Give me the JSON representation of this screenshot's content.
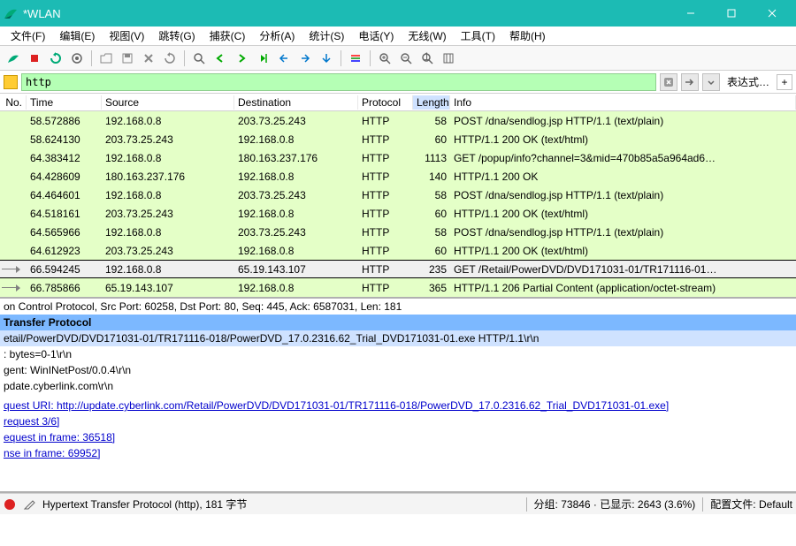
{
  "title": "*WLAN",
  "menu": [
    "文件(F)",
    "编辑(E)",
    "视图(V)",
    "跳转(G)",
    "捕获(C)",
    "分析(A)",
    "统计(S)",
    "电话(Y)",
    "无线(W)",
    "工具(T)",
    "帮助(H)"
  ],
  "filter": {
    "value": "http",
    "expr_label": "表达式…",
    "plus": "+"
  },
  "columns": {
    "no": "No.",
    "time": "Time",
    "src": "Source",
    "dst": "Destination",
    "proto": "Protocol",
    "len": "Length",
    "info": "Info"
  },
  "rows": [
    {
      "time": "58.572886",
      "src": "192.168.0.8",
      "dst": "203.73.25.243",
      "proto": "HTTP",
      "len": "58",
      "info": "POST /dna/sendlog.jsp HTTP/1.1  (text/plain)",
      "cls": "green"
    },
    {
      "time": "58.624130",
      "src": "203.73.25.243",
      "dst": "192.168.0.8",
      "proto": "HTTP",
      "len": "60",
      "info": "HTTP/1.1 200 OK  (text/html)",
      "cls": "green"
    },
    {
      "time": "64.383412",
      "src": "192.168.0.8",
      "dst": "180.163.237.176",
      "proto": "HTTP",
      "len": "1113",
      "info": "GET /popup/info?channel=3&mid=470b85a5a964ad6…",
      "cls": "green"
    },
    {
      "time": "64.428609",
      "src": "180.163.237.176",
      "dst": "192.168.0.8",
      "proto": "HTTP",
      "len": "140",
      "info": "HTTP/1.1 200 OK",
      "cls": "green"
    },
    {
      "time": "64.464601",
      "src": "192.168.0.8",
      "dst": "203.73.25.243",
      "proto": "HTTP",
      "len": "58",
      "info": "POST /dna/sendlog.jsp HTTP/1.1  (text/plain)",
      "cls": "green"
    },
    {
      "time": "64.518161",
      "src": "203.73.25.243",
      "dst": "192.168.0.8",
      "proto": "HTTP",
      "len": "60",
      "info": "HTTP/1.1 200 OK  (text/html)",
      "cls": "green"
    },
    {
      "time": "64.565966",
      "src": "192.168.0.8",
      "dst": "203.73.25.243",
      "proto": "HTTP",
      "len": "58",
      "info": "POST /dna/sendlog.jsp HTTP/1.1  (text/plain)",
      "cls": "green"
    },
    {
      "time": "64.612923",
      "src": "203.73.25.243",
      "dst": "192.168.0.8",
      "proto": "HTTP",
      "len": "60",
      "info": "HTTP/1.1 200 OK  (text/html)",
      "cls": "green"
    },
    {
      "time": "66.594245",
      "src": "192.168.0.8",
      "dst": "65.19.143.107",
      "proto": "HTTP",
      "len": "235",
      "info": "GET /Retail/PowerDVD/DVD171031-01/TR171116-01…",
      "cls": "sel",
      "arrow": true
    },
    {
      "time": "66.785866",
      "src": "65.19.143.107",
      "dst": "192.168.0.8",
      "proto": "HTTP",
      "len": "365",
      "info": "HTTP/1.1 206 Partial Content  (application/octet-stream)",
      "cls": "green",
      "arrow": true
    }
  ],
  "details": [
    {
      "t": "on Control Protocol, Src Port: 60258, Dst Port: 80, Seq: 445, Ack: 6587031, Len: 181",
      "c": ""
    },
    {
      "t": " Transfer Protocol",
      "c": "hdr"
    },
    {
      "t": "etail/PowerDVD/DVD171031-01/TR171116-018/PowerDVD_17.0.2316.62_Trial_DVD171031-01.exe HTTP/1.1\\r\\n",
      "c": "sub"
    },
    {
      "t": ": bytes=0-1\\r\\n",
      "c": ""
    },
    {
      "t": "gent: WinINetPost/0.0.4\\r\\n",
      "c": ""
    },
    {
      "t": "pdate.cyberlink.com\\r\\n",
      "c": ""
    },
    {
      "t": " ",
      "c": ""
    },
    {
      "t": "quest URI: http://update.cyberlink.com/Retail/PowerDVD/DVD171031-01/TR171116-018/PowerDVD_17.0.2316.62_Trial_DVD171031-01.exe]",
      "c": "link"
    },
    {
      "t": "request 3/6]",
      "c": "link"
    },
    {
      "t": "equest in frame: 36518]",
      "c": "link"
    },
    {
      "t": "nse in frame: 69952]",
      "c": "link"
    }
  ],
  "status": {
    "main": "Hypertext Transfer Protocol (http), 181 字节",
    "pkts": "分组: 73846 · 已显示: 2643 (3.6%)",
    "profile": "配置文件: Default"
  }
}
